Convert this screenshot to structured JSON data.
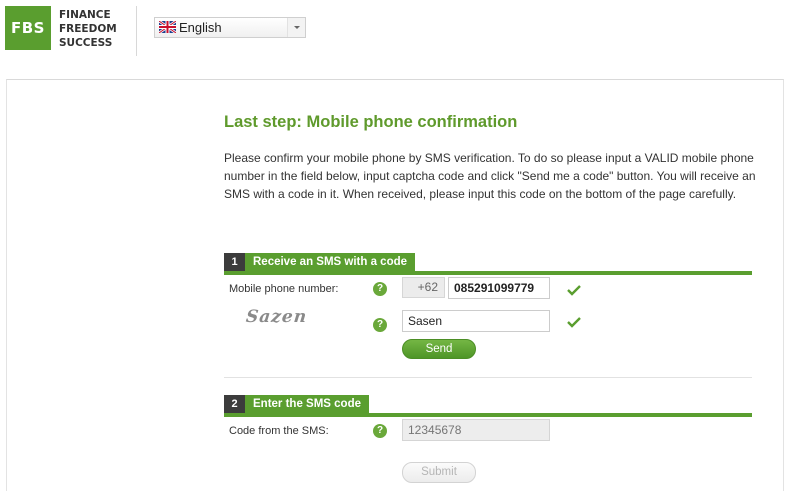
{
  "logo": {
    "mark": "FBS",
    "lines": [
      "FINANCE",
      "FREEDOM",
      "SUCCESS"
    ]
  },
  "language": {
    "selected": "English",
    "flag_icon": "uk-flag-icon"
  },
  "page": {
    "title": "Last step: Mobile phone confirmation",
    "intro": "Please confirm your mobile phone by SMS verification. To do so please input a VALID mobile phone number in the field below, input captcha code and click \"Send me a code\" button. You will receive an SMS with a code in it. When received, please input this code on the bottom of the page carefully."
  },
  "step1": {
    "number": "1",
    "title": "Receive an SMS with a code",
    "phone_label": "Mobile phone number:",
    "phone_prefix": "+62",
    "phone_value": "085291099779",
    "captcha_image_text": "Sazen",
    "captcha_value": "Sasen",
    "send_label": "Send"
  },
  "step2": {
    "number": "2",
    "title": "Enter the SMS code",
    "code_label": "Code from the SMS:",
    "code_placeholder": "12345678",
    "submit_label": "Submit"
  },
  "colors": {
    "brand_green": "#5a9e2f",
    "step_number_bg": "#3c3c3c",
    "check_green": "#5a9e2f"
  },
  "icons": {
    "help": "?"
  }
}
